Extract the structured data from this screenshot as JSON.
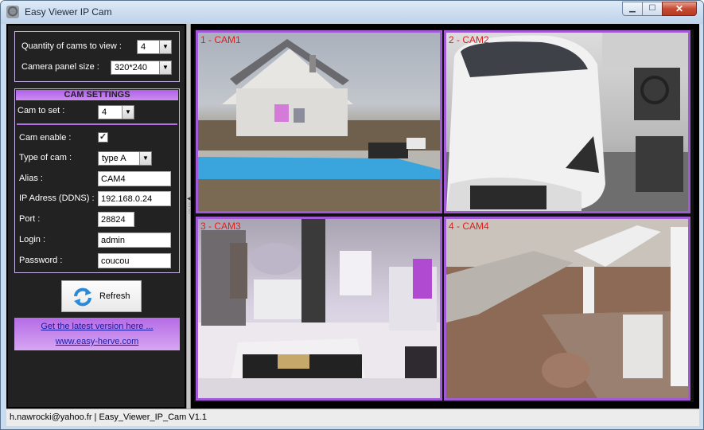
{
  "window": {
    "title": "Easy Viewer IP Cam",
    "caption_buttons": {
      "minimize": "▁",
      "maximize": "☐",
      "close": "✕"
    }
  },
  "view_settings": {
    "cams_label": "Quantity of cams to view :",
    "cams_value": "4",
    "panel_size_label": "Camera panel size :",
    "panel_size_value": "320*240"
  },
  "cam_settings": {
    "header": "CAM SETTINGS",
    "cam_to_set_label": "Cam to set :",
    "cam_to_set_value": "4",
    "enable_label": "Cam enable :",
    "enable_checked": true,
    "type_label": "Type of cam :",
    "type_value": "type A",
    "alias_label": "Alias :",
    "alias_value": "CAM4",
    "ip_label": "IP Adress (DDNS) :",
    "ip_value": "192.168.0.24",
    "port_label": "Port :",
    "port_value": "28824",
    "login_label": "Login :",
    "login_value": "admin",
    "password_label": "Password :",
    "password_value": "coucou"
  },
  "refresh_label": "Refresh",
  "links": {
    "latest_version": "Get the latest version here ...",
    "website": "www.easy-herve.com"
  },
  "cams": [
    {
      "label": "1 - CAM1"
    },
    {
      "label": "2 - CAM2"
    },
    {
      "label": "3 - CAM3"
    },
    {
      "label": "4 - CAM4"
    }
  ],
  "status_bar": "h.nawrocki@yahoo.fr  |  Easy_Viewer_IP_Cam V1.1",
  "colors": {
    "accent": "#a35ad8",
    "cam_label": "#e01e1e",
    "link": "#1a1aa8"
  }
}
